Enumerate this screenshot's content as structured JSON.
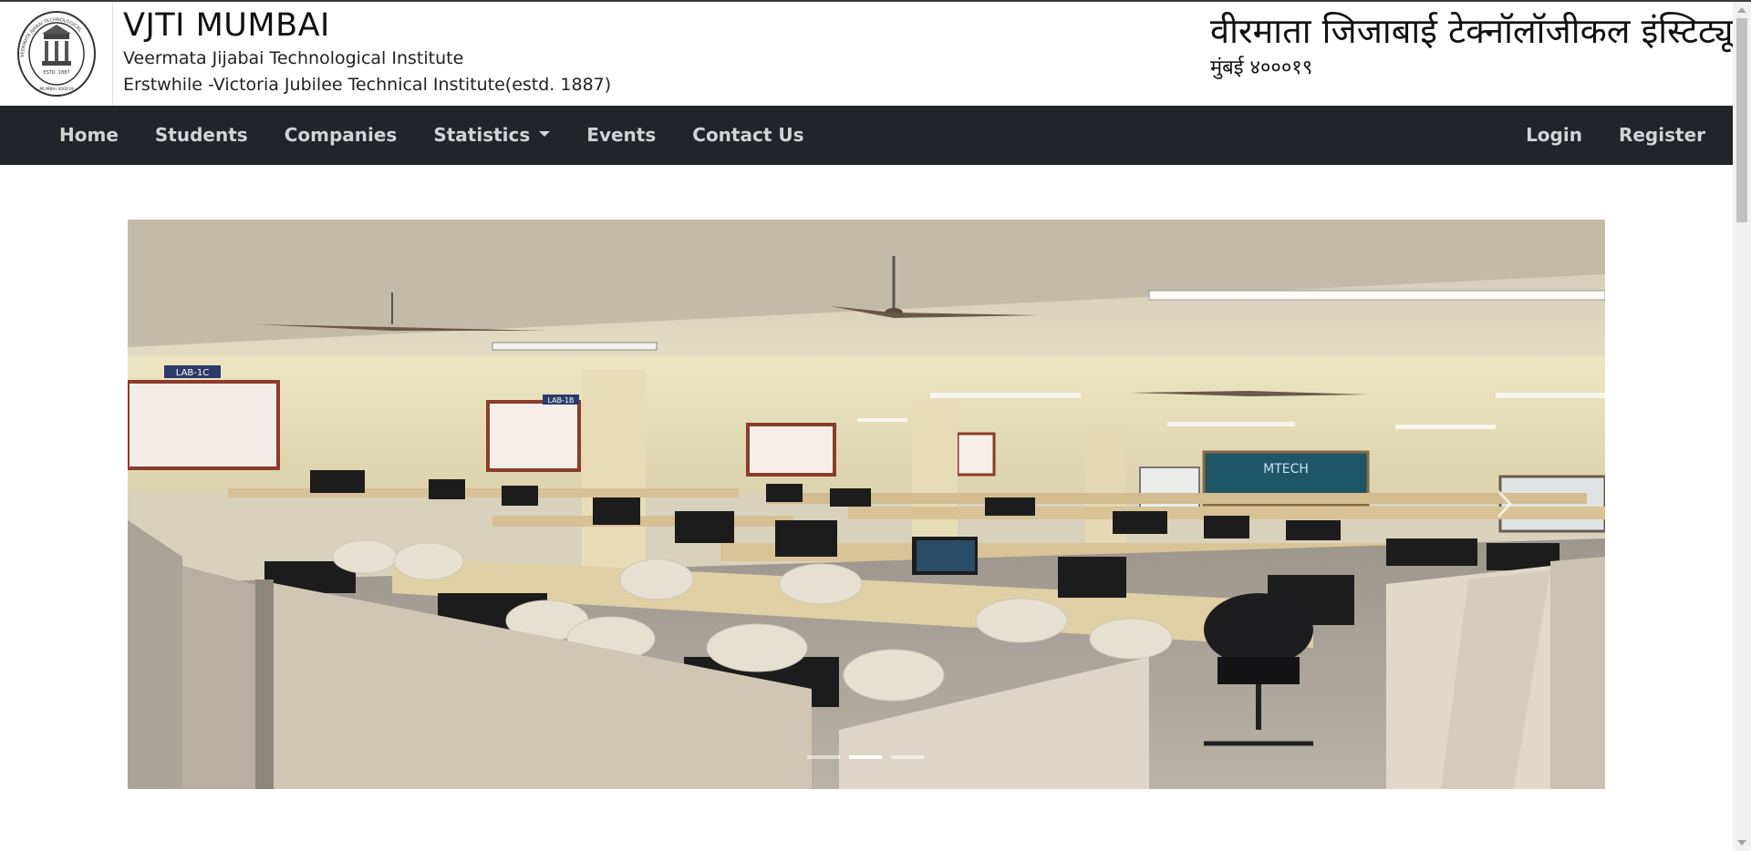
{
  "header": {
    "title": "VJTI MUMBAI",
    "subtitle1": "Veermata Jijabai Technological Institute",
    "subtitle2": "Erstwhile -Victoria Jubilee Technical Institute(estd. 1887)",
    "marathi_title": "वीरमाता जिजाबाई टेक्नॉलॉजीकल इंस्टिट्यूट",
    "marathi_sub": "मुंबई ४०००१९",
    "logo": {
      "ring_text": "VEERMATA JIJABAI TECHNOLOGICAL",
      "estd": "ESTD. 1887",
      "city": "MUMBAI 400019"
    }
  },
  "nav": {
    "home": "Home",
    "students": "Students",
    "companies": "Companies",
    "statistics": "Statistics",
    "events": "Events",
    "contact": "Contact Us",
    "login": "Login",
    "register": "Register"
  },
  "carousel": {
    "slide_count": 3,
    "active_index": 1,
    "sign_lab1": "LAB-1C",
    "sign_lab2": "LAB-1B",
    "board_text": "MTECH"
  },
  "colors": {
    "navbar_bg": "#212529",
    "nav_text": "#d2d3d4"
  }
}
